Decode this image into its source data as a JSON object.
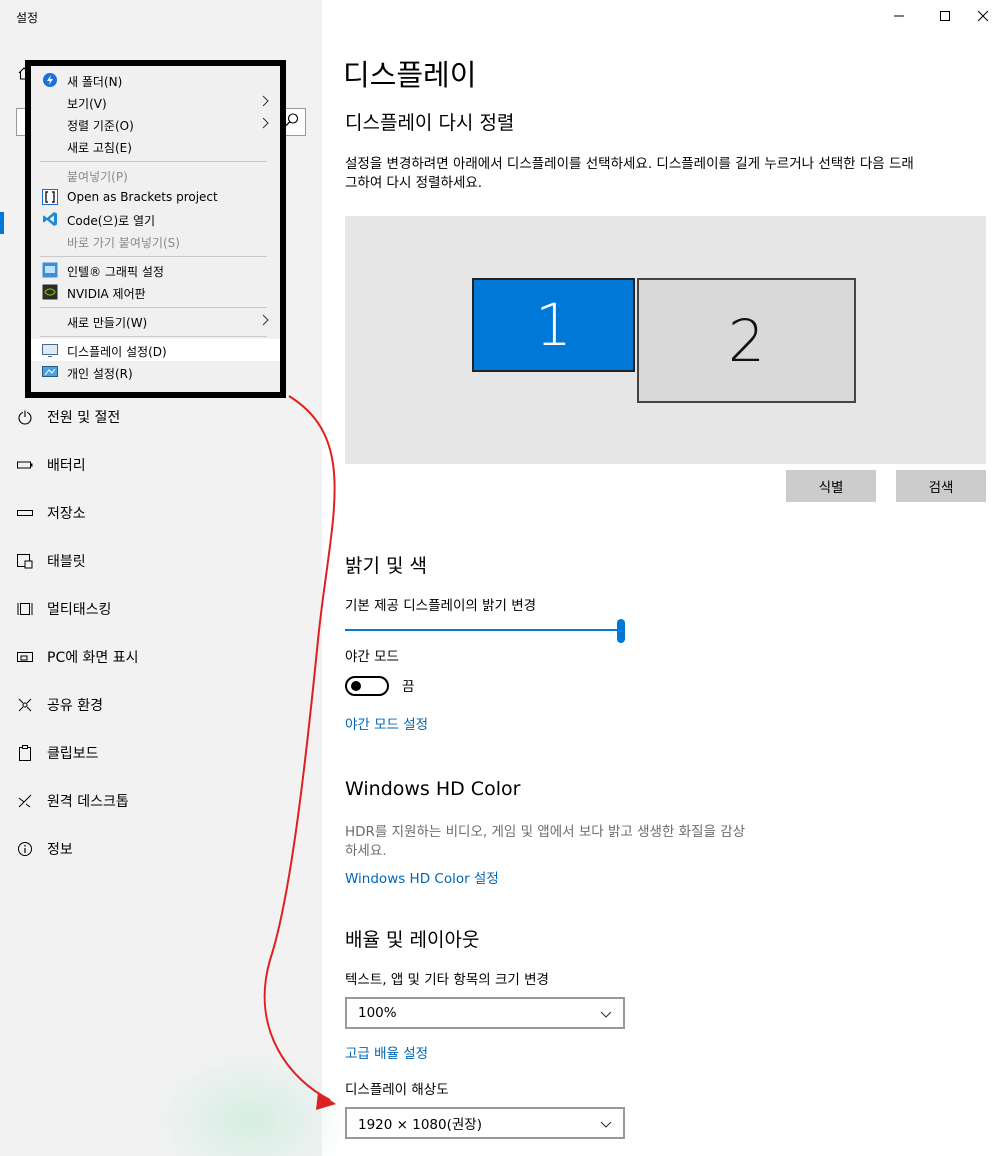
{
  "window": {
    "title": "설정",
    "minimize_icon": "minimize-icon",
    "maximize_icon": "maximize-icon",
    "close_icon": "close-icon"
  },
  "sidebar": {
    "items": [
      {
        "label": "전원 및 절전",
        "icon": "power-icon"
      },
      {
        "label": "배터리",
        "icon": "battery-icon"
      },
      {
        "label": "저장소",
        "icon": "storage-icon"
      },
      {
        "label": "태블릿",
        "icon": "tablet-icon"
      },
      {
        "label": "멀티태스킹",
        "icon": "multitasking-icon"
      },
      {
        "label": "PC에 화면 표시",
        "icon": "project-icon"
      },
      {
        "label": "공유 환경",
        "icon": "shared-icon"
      },
      {
        "label": "클립보드",
        "icon": "clipboard-icon"
      },
      {
        "label": "원격 데스크톱",
        "icon": "remote-desktop-icon"
      },
      {
        "label": "정보",
        "icon": "info-icon"
      }
    ]
  },
  "context_menu": {
    "items": [
      {
        "label": "새 폴더(N)",
        "icon": "new-folder-icon"
      },
      {
        "label": "보기(V)",
        "submenu": true
      },
      {
        "label": "정렬 기준(O)",
        "submenu": true
      },
      {
        "label": "새로 고침(E)"
      },
      {
        "label": "붙여넣기(P)",
        "disabled": true
      },
      {
        "label": "Open as Brackets project",
        "icon": "brackets-icon"
      },
      {
        "label": "Code(으)로 열기",
        "icon": "vscode-icon"
      },
      {
        "label": "바로 가기 붙여넣기(S)",
        "disabled": true
      },
      {
        "label": "인텔® 그래픽 설정",
        "icon": "intel-graphics-icon"
      },
      {
        "label": "NVIDIA 제어판",
        "icon": "nvidia-icon"
      },
      {
        "label": "새로 만들기(W)",
        "submenu": true
      },
      {
        "label": "디스플레이 설정(D)",
        "icon": "display-settings-icon",
        "highlighted": true
      },
      {
        "label": "개인 설정(R)",
        "icon": "personalize-icon"
      }
    ]
  },
  "main": {
    "title": "디스플레이",
    "rearrange": {
      "heading": "디스플레이 다시 정렬",
      "description_line1": "설정을 변경하려면 아래에서 디스플레이를 선택하세요. 디스플레이를 길게 누르거나 선택한 다음 드래",
      "description_line2": "그하여 다시 정렬하세요.",
      "monitor1": "1",
      "monitor2": "2",
      "identify_button": "식별",
      "detect_button": "검색"
    },
    "brightness": {
      "heading": "밝기 및 색",
      "slider_label": "기본 제공 디스플레이의 밝기 변경",
      "brightness_value": 100,
      "night_light_label": "야간 모드",
      "night_light_state": "끔",
      "night_light_on": false,
      "night_light_link": "야간 모드 설정"
    },
    "hdr": {
      "heading": "Windows HD Color",
      "description_line1": "HDR를 지원하는 비디오, 게임 및 앱에서 보다 밝고 생생한 화질을 감상",
      "description_line2": "하세요.",
      "link": "Windows HD Color 설정"
    },
    "scale": {
      "heading": "배율 및 레이아웃",
      "scale_label": "텍스트, 앱 및 기타 항목의 크기 변경",
      "scale_value": "100%",
      "advanced_link": "고급 배율 설정",
      "resolution_label": "디스플레이 해상도",
      "resolution_value": "1920 × 1080(권장)"
    }
  },
  "colors": {
    "accent": "#0078d7",
    "link": "#0067b8",
    "annotation_arrow": "#e02020"
  }
}
